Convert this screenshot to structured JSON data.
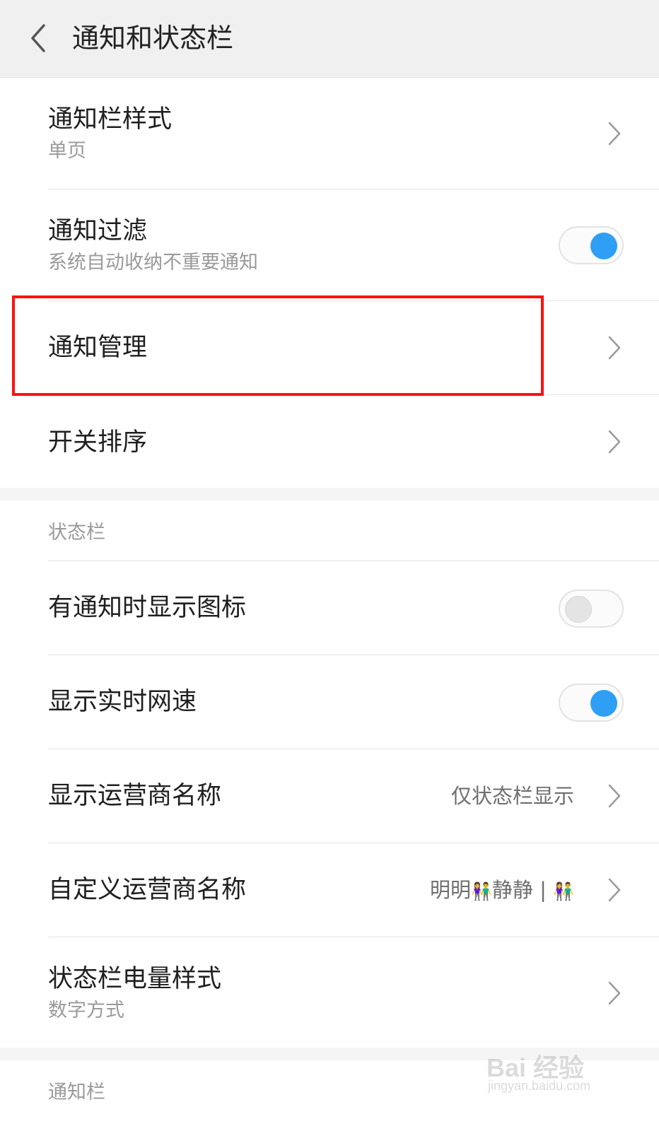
{
  "header": {
    "title": "通知和状态栏"
  },
  "notifications": {
    "items": [
      {
        "title": "通知栏样式",
        "subtitle": "单页"
      },
      {
        "title": "通知过滤",
        "subtitle": "系统自动收纳不重要通知",
        "toggle": "on"
      },
      {
        "title": "通知管理"
      },
      {
        "title": "开关排序"
      }
    ]
  },
  "status_bar": {
    "section_label": "状态栏",
    "items": [
      {
        "title": "有通知时显示图标",
        "toggle": "off"
      },
      {
        "title": "显示实时网速",
        "toggle": "on"
      },
      {
        "title": "显示运营商名称",
        "value": "仅状态栏显示"
      },
      {
        "title": "自定义运营商名称",
        "value_a": "明明",
        "value_b": "静静 |"
      },
      {
        "title": "状态栏电量样式",
        "subtitle": "数字方式"
      }
    ]
  },
  "next_section": {
    "section_label": "通知栏"
  },
  "watermark": {
    "brand": "Bai  经验",
    "url": "jingyan.baidu.com"
  },
  "colors": {
    "toggle_on": "#2e9ff5",
    "highlight": "#ff1010"
  }
}
